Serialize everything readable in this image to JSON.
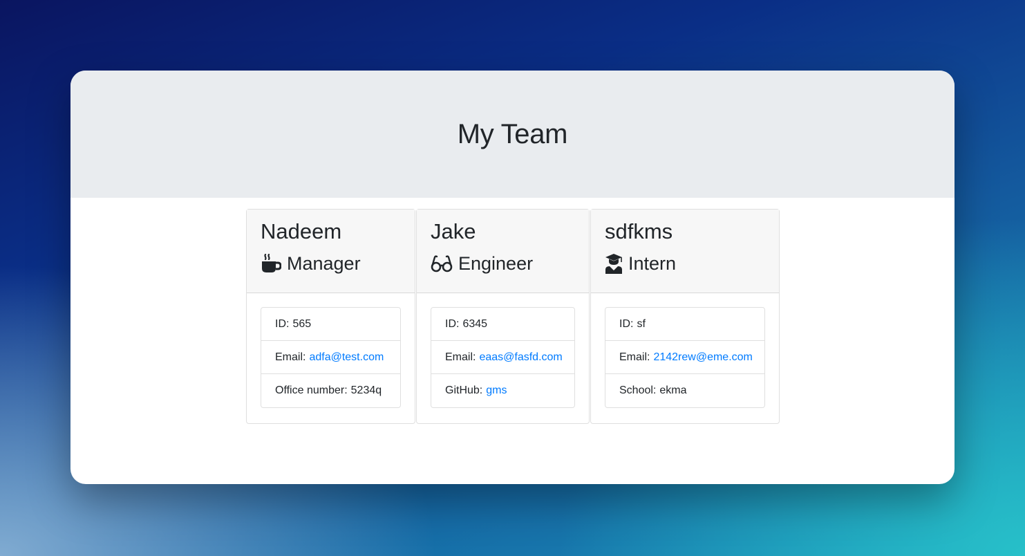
{
  "page": {
    "title": "My Team"
  },
  "team": [
    {
      "name": "Nadeem",
      "role": "Manager",
      "icon": "coffee-icon",
      "id_label": "ID:",
      "id": "565",
      "email_label": "Email:",
      "email": "adfa@test.com",
      "extra_label": "Office number:",
      "extra_value": "5234q"
    },
    {
      "name": "Jake",
      "role": "Engineer",
      "icon": "glasses-icon",
      "id_label": "ID:",
      "id": "6345",
      "email_label": "Email:",
      "email": "eaas@fasfd.com",
      "extra_label": "GitHub:",
      "extra_value": "gms"
    },
    {
      "name": "sdfkms",
      "role": "Intern",
      "icon": "user-graduate-icon",
      "id_label": "ID:",
      "id": "sf",
      "email_label": "Email:",
      "email": "2142rew@eme.com",
      "extra_label": "School:",
      "extra_value": "ekma"
    }
  ],
  "colors": {
    "link": "#007bff",
    "text": "#212529",
    "jumbotron": "#e9ecef"
  }
}
